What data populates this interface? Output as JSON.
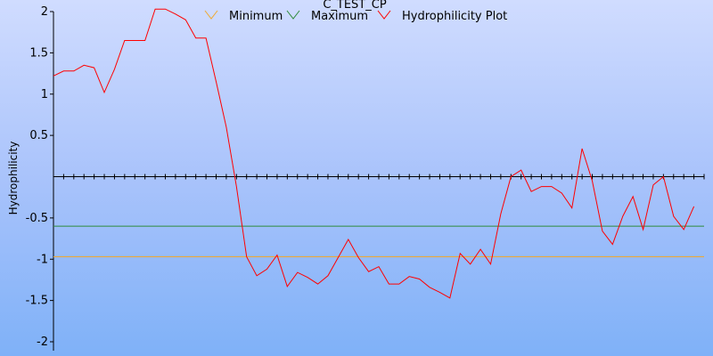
{
  "chart_data": {
    "type": "line",
    "title": "C_TEST_CP",
    "xlabel": "",
    "ylabel": "Hydrophilicity",
    "ylim": [
      -2,
      2
    ],
    "yticks": [
      2,
      1.5,
      1,
      0.5,
      -0.5,
      -1,
      -1.5,
      -2
    ],
    "xlim": [
      0,
      64
    ],
    "grid": false,
    "legend_position": "top",
    "series": [
      {
        "name": "Minimum",
        "color": "#f0a830",
        "y": -0.97
      },
      {
        "name": "Maximum",
        "color": "#2e8b3a",
        "y": -0.6
      },
      {
        "name": "Hydrophilicity Plot",
        "color": "#ff0000",
        "x": [
          0,
          1,
          2,
          3,
          4,
          5,
          6,
          7,
          8,
          9,
          10,
          11,
          12,
          13,
          14,
          15,
          16,
          17,
          18,
          19,
          20,
          21,
          22,
          23,
          24,
          25,
          26,
          27,
          28,
          29,
          30,
          31,
          32,
          33,
          34,
          35,
          36,
          37,
          38,
          39,
          40,
          41,
          42,
          43,
          44,
          45,
          46,
          47,
          48,
          49,
          50,
          51,
          52,
          53,
          54,
          55,
          56,
          57,
          58,
          59,
          60,
          61,
          62,
          63
        ],
        "values": [
          1.22,
          1.28,
          1.28,
          1.35,
          1.32,
          1.02,
          1.3,
          1.65,
          1.65,
          1.65,
          2.03,
          2.03,
          1.97,
          1.9,
          1.68,
          1.68,
          1.15,
          0.6,
          -0.12,
          -0.97,
          -1.2,
          -1.12,
          -0.95,
          -1.33,
          -1.16,
          -1.22,
          -1.3,
          -1.2,
          -0.98,
          -0.76,
          -0.98,
          -1.15,
          -1.09,
          -1.3,
          -1.3,
          -1.21,
          -1.24,
          -1.34,
          -1.4,
          -1.47,
          -0.93,
          -1.06,
          -0.88,
          -1.06,
          -0.45,
          0.0,
          0.08,
          -0.18,
          -0.12,
          -0.12,
          -0.2,
          -0.38,
          0.34,
          -0.05,
          -0.66,
          -0.82,
          -0.48,
          -0.24,
          -0.64,
          -0.1,
          0.0,
          -0.48,
          -0.64,
          -0.36
        ]
      }
    ]
  }
}
